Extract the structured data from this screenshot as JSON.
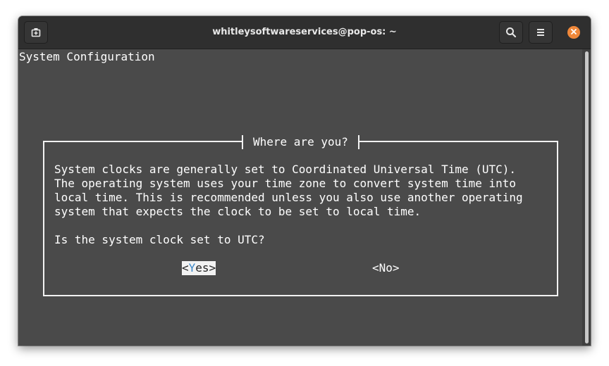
{
  "window": {
    "title": "whitleysoftwareservices@pop-os: ~",
    "buttons": {
      "new_tab_icon": "new-tab-icon",
      "search_icon": "search-icon",
      "menu_icon": "hamburger-menu-icon",
      "close_icon": "close-icon"
    },
    "colors": {
      "close_button": "#f0883a",
      "terminal_background": "#4a4a4a",
      "titlebar": "#2f2f2f"
    }
  },
  "terminal": {
    "screen_title": "System Configuration",
    "dialog": {
      "title": "Where are you?",
      "body": "System clocks are generally set to Coordinated Universal Time (UTC).\nThe operating system uses your time zone to convert system time into\nlocal time. This is recommended unless you also use another operating\nsystem that expects the clock to be set to local time.\n\nIs the system clock set to UTC?",
      "yes": {
        "prefix": "<",
        "hotkey": "Y",
        "suffix": "es>"
      },
      "no_label": "<No>",
      "colors": {
        "hotkey": "#3a86c8",
        "selected_button_bg": "#f2f2f2"
      }
    }
  }
}
